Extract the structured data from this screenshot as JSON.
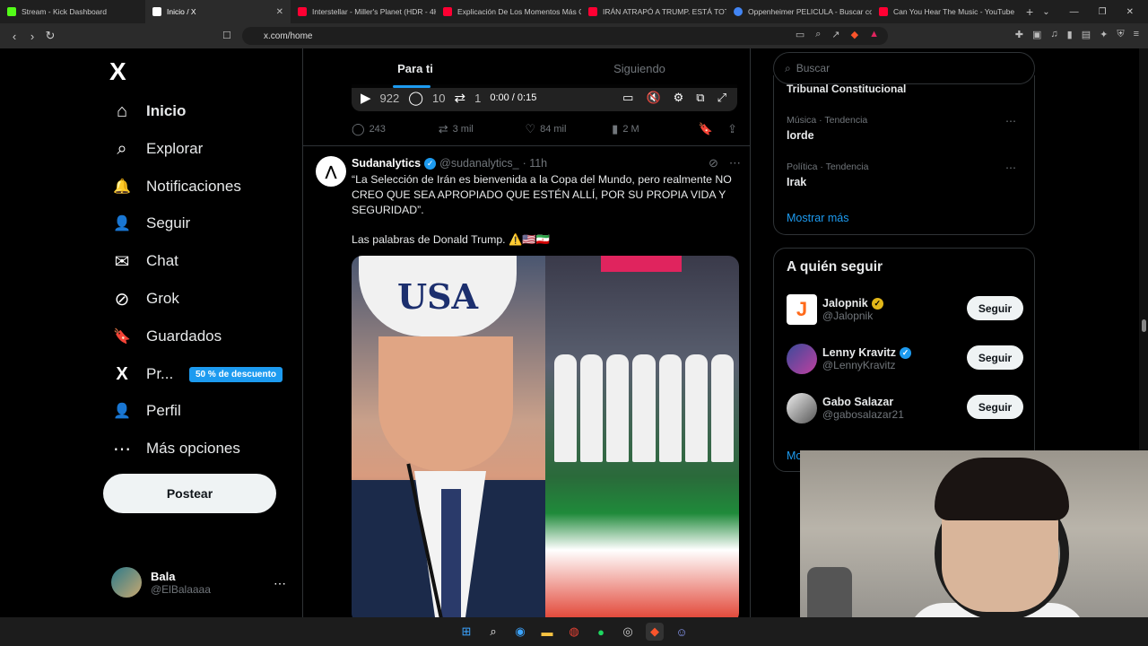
{
  "browser": {
    "tabs": [
      {
        "label": "Stream - Kick Dashboard",
        "color": "#53fc18"
      },
      {
        "label": "Inicio / X",
        "color": "#ffffff",
        "active": true
      },
      {
        "label": "Interstellar - Miller's Planet (HDR - 4K",
        "color": "#ff0033"
      },
      {
        "label": "Explicación De Los Momentos Más C",
        "color": "#ff0033"
      },
      {
        "label": "IRÁN ATRAPÓ A TRUMP. ESTÁ TOTAL",
        "color": "#ff0033"
      },
      {
        "label": "Oppenheimer PELICULA - Buscar con",
        "color": "#4285f4"
      },
      {
        "label": "Can You Hear The Music - YouTube",
        "color": "#ff0033"
      }
    ],
    "url": "x.com/home"
  },
  "nav": {
    "logo": "X",
    "items": [
      {
        "label": "Inicio",
        "icon": "home-icon",
        "glyph": "⌂"
      },
      {
        "label": "Explorar",
        "icon": "search-icon",
        "glyph": "⌕"
      },
      {
        "label": "Notificaciones",
        "icon": "bell-icon",
        "glyph": "🔔"
      },
      {
        "label": "Seguir",
        "icon": "add-user-icon",
        "glyph": "👤"
      },
      {
        "label": "Chat",
        "icon": "mail-icon",
        "glyph": "✉"
      },
      {
        "label": "Grok",
        "icon": "grok-icon",
        "glyph": "⊘"
      },
      {
        "label": "Guardados",
        "icon": "bookmark-icon",
        "glyph": "🔖"
      },
      {
        "label": "Pr...",
        "icon": "premium-x-icon",
        "glyph": "X"
      },
      {
        "label": "Perfil",
        "icon": "profile-icon",
        "glyph": "👤"
      },
      {
        "label": "Más opciones",
        "icon": "more-icon",
        "glyph": "⋯"
      }
    ],
    "promo": "50 % de descuento",
    "post_button": "Postear",
    "user": {
      "name": "Bala",
      "handle": "@ElBalaaaa"
    }
  },
  "feed": {
    "tabs": [
      "Para ti",
      "Siguiendo"
    ],
    "video": {
      "views": "922",
      "replies": "10",
      "reposts": "1",
      "time": "0:00 / 0:15"
    },
    "prev_actions": {
      "replies": "243",
      "reposts": "3 mil",
      "likes": "84 mil",
      "views": "2 M"
    },
    "tweet": {
      "name": "Sudanalytics",
      "handle": "@sudanalytics_",
      "time": "· 11h",
      "text": "“La Selección de Irán es bienvenida a la Copa del Mundo, pero realmente NO CREO QUE SEA APROPIADO QUE ESTÉN ALLÍ, POR SU PROPIA VIDA Y SEGURIDAD”.",
      "text2": "Las palabras de Donald Trump. ⚠️🇺🇸🇮🇷",
      "cap_text": "USA"
    }
  },
  "right": {
    "search_placeholder": "Buscar",
    "trend_cut": "Tribunal Constitucional",
    "trends": [
      {
        "category": "Música · Tendencia",
        "name": "lorde"
      },
      {
        "category": "Política · Tendencia",
        "name": "Irak"
      }
    ],
    "show_more": "Mostrar más",
    "who_title": "A quién seguir",
    "who": [
      {
        "name": "Jalopnik",
        "handle": "@Jalopnik",
        "badge": "gold",
        "color": "#ff6a1a"
      },
      {
        "name": "Lenny Kravitz",
        "handle": "@LennyKravitz",
        "badge": "blue",
        "color": "#3a4a9a"
      },
      {
        "name": "Gabo Salazar",
        "handle": "@gabosalazar21",
        "badge": "none",
        "color": "#e8e8e8"
      }
    ],
    "follow_label": "Seguir",
    "show_more2": "Mostrar más"
  }
}
